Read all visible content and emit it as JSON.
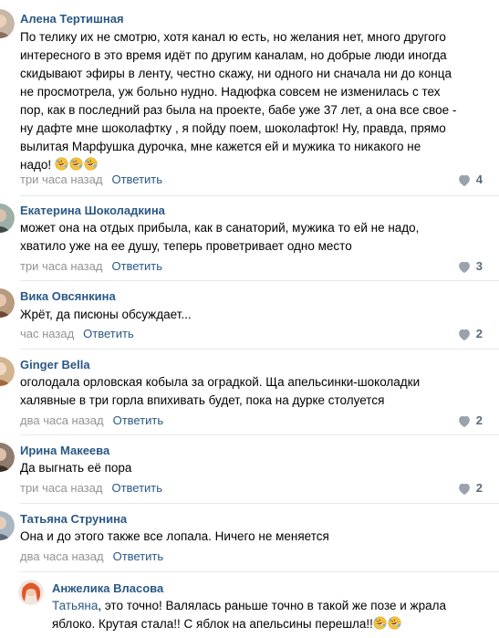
{
  "comments": [
    {
      "author": "Алена Тертишная",
      "lines": [
        "По телику их не смотрю, хотя канал ю есть, но желания нет, много другого",
        "интересного в это время идёт по другим каналам, но добрые люди иногда",
        "скидывают эфиры в ленту, честно скажу, ни одного ни сначала ни до конца",
        "не просмотрела, уж больно нудно. Надюфка совсем не изменилась с тех",
        "пор, как в последний раз была на проекте, бабе уже 37 лет, а она все свое -",
        "ну дафте мне шоколафтку , я пойду поем, шоколафток! Ну, правда, прямо",
        "вылитая Марфушка дурочка, мне кажется ей и мужика то никакого не"
      ],
      "last_line": "надо!",
      "time": "три часа назад",
      "reply": "Ответить",
      "likes": "4"
    },
    {
      "author": "Екатерина Шоколадкина",
      "lines": [
        "может она на отдых прибыла, как в санаторий, мужика то ей не надо,",
        "хватило уже на ее душу, теперь проветривает одно место"
      ],
      "time": "три часа назад",
      "reply": "Ответить",
      "likes": "3"
    },
    {
      "author": "Вика Овсянкина",
      "lines": [
        "Жрёт, да писюны обсуждает..."
      ],
      "time": "час назад",
      "reply": "Ответить",
      "likes": "2"
    },
    {
      "author": "Ginger Bella",
      "lines": [
        "оголодала орловская кобыла за оградкой. Ща апельсинки-шоколадки",
        "халявные в три горла впихивать будет, пока на дурке столуется"
      ],
      "time": "два часа назад",
      "reply": "Ответить",
      "likes": "2"
    },
    {
      "author": "Ирина Макеева",
      "lines": [
        "Да выгнать её пора"
      ],
      "time": "три часа назад",
      "reply": "Ответить",
      "likes": "2"
    },
    {
      "author": "Татьяна Струнина",
      "lines": [
        "Она и до этого также все лопала. Ничего не меняется"
      ],
      "time": "два часа назад",
      "reply": "Ответить",
      "likes": ""
    }
  ],
  "reply_comment": {
    "author": "Анжелика Власова",
    "mention": "Татьяна",
    "line1_rest": ", это точно! Валялась раньше точно в такой же позе и жрала",
    "line2": "яблоко. Крутая стала!! С яблок на апельсины перешла!!"
  },
  "colors": {
    "link": "#2a5885",
    "meta": "#939393",
    "separator": "#e7e8ec",
    "like_icon": "#5a6a7c"
  }
}
